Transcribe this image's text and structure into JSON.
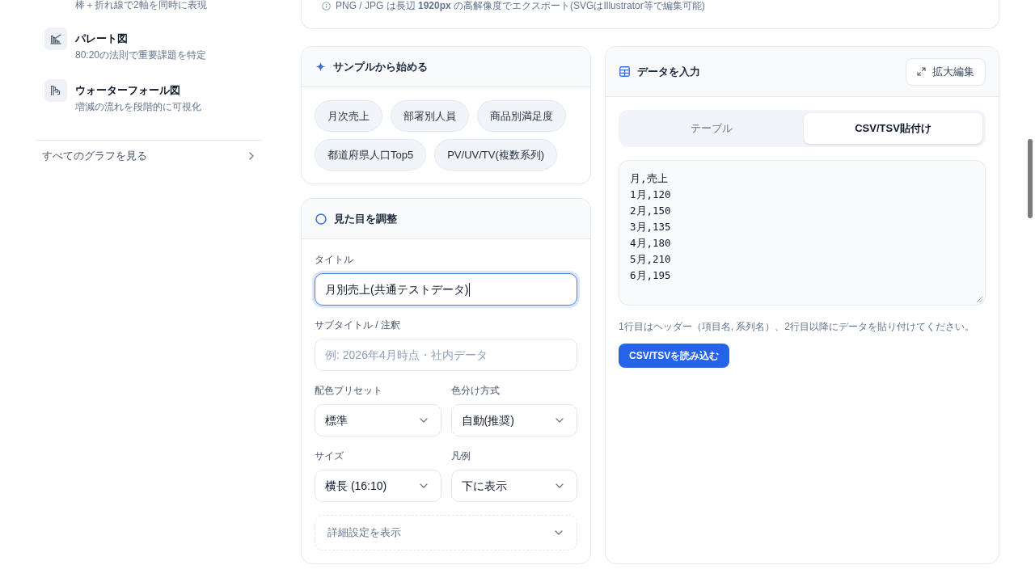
{
  "sidebar": {
    "items": [
      {
        "description": "棒＋折れ線で2軸を同時に表現"
      },
      {
        "title": "パレート図",
        "description": "80:20の法則で重要課題を特定"
      },
      {
        "title": "ウォーターフォール図",
        "description": "増減の流れを段階的に可視化"
      }
    ],
    "see_all_link": "すべてのグラフを見る"
  },
  "export_note": "PNG / JPG は長辺 **1920px** の高解像度でエクスポート(SVGはIllustrator等で編集可能)",
  "samples_panel": {
    "title": "サンプルから始める",
    "chips": [
      "月次売上",
      "部署別人員",
      "商品別満足度",
      "都道府県人口Top5",
      "PV/UV/TV(複数系列)"
    ]
  },
  "appearance_panel": {
    "title": "見た目を調整",
    "fields": [
      {
        "kind": "text",
        "label": "タイトル",
        "value": "月別売上(共通テストデータ)",
        "focused": true
      },
      {
        "kind": "text",
        "label": "サブタイトル / 注釈",
        "placeholder": "例: 2026年4月時点・社内データ",
        "focused": false
      },
      {
        "kind": "select",
        "label": "配色プリセット",
        "value": "標準"
      },
      {
        "kind": "select",
        "label": "色分け方式",
        "value": "自動(推奨)"
      },
      {
        "kind": "select",
        "label": "サイズ",
        "value": "横長 (16:10)"
      },
      {
        "kind": "select",
        "label": "凡例",
        "value": "下に表示"
      }
    ],
    "advanced_toggle": {
      "label": "詳細設定を表示",
      "expanded": false
    }
  },
  "data_panel": {
    "title": "データを入力",
    "expand_button": "拡大編集",
    "tabs": [
      {
        "label": "テーブル",
        "selected": false
      },
      {
        "label": "CSV/TSV貼付け",
        "selected": true
      }
    ],
    "csv_text": "月,売上\n1月,120\n2月,150\n3月,135\n4月,180\n5月,210\n6月,195",
    "hint": "1行目はヘッダー（項目名, 系列名）、2行目以降にデータを貼り付けてください。",
    "load_button": "CSV/TSVを読み込む"
  }
}
